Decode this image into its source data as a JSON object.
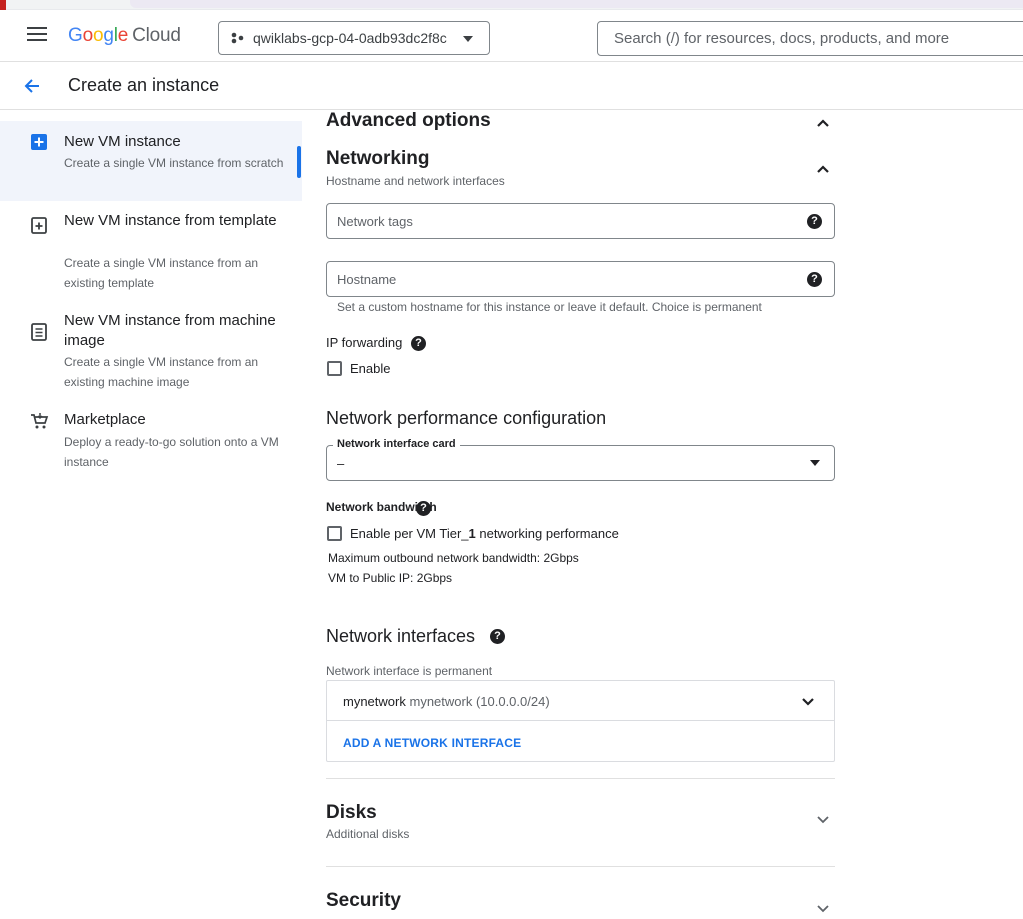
{
  "header": {
    "logo": [
      "G",
      "o",
      "o",
      "g",
      "l",
      "e"
    ],
    "logo_cloud": "Cloud",
    "project": "qwiklabs-gcp-04-0adb93dc2f8c",
    "search_placeholder": "Search (/) for resources, docs, products, and more"
  },
  "page": {
    "title": "Create an instance"
  },
  "sidebar": {
    "items": [
      {
        "title": "New VM instance",
        "desc": "Create a single VM instance from scratch",
        "icon": "add-box-icon"
      },
      {
        "title": "New VM instance from template",
        "desc": "Create a single VM instance from an existing template",
        "icon": "template-icon"
      },
      {
        "title": "New VM instance from machine image",
        "desc": "Create a single VM instance from an existing machine image",
        "icon": "machine-image-icon"
      },
      {
        "title": "Marketplace",
        "desc": "Deploy a ready-to-go solution onto a VM instance",
        "icon": "cart-icon"
      }
    ]
  },
  "main": {
    "advanced_title": "Advanced options",
    "networking": {
      "title": "Networking",
      "subtitle": "Hostname and network interfaces",
      "network_tags_placeholder": "Network tags",
      "hostname_placeholder": "Hostname",
      "hostname_hint": "Set a custom hostname for this instance or leave it default. Choice is permanent",
      "ip_forwarding_label": "IP forwarding",
      "ip_forwarding_checkbox": "Enable"
    },
    "performance": {
      "title": "Network performance configuration",
      "nic_label": "Network interface card",
      "nic_value": "–",
      "bandwidth_label": "Network bandwidth",
      "tier1_checkbox_prefix": "Enable per VM Tier_",
      "tier1_checkbox_bold": "1",
      "tier1_checkbox_suffix": " networking performance",
      "max_outbound": "Maximum outbound network bandwidth: 2Gbps",
      "vm_public": "VM to Public IP: 2Gbps"
    },
    "interfaces": {
      "title": "Network interfaces",
      "note": "Network interface is permanent",
      "row_name": "mynetwork",
      "row_detail": "mynetwork (10.0.0.0/24)",
      "add_label": "ADD A NETWORK INTERFACE"
    },
    "disks": {
      "title": "Disks",
      "subtitle": "Additional disks"
    },
    "security": {
      "title": "Security"
    }
  },
  "colors": {
    "accent": "#1a73e8",
    "active_bg": "#f1f4fb"
  }
}
